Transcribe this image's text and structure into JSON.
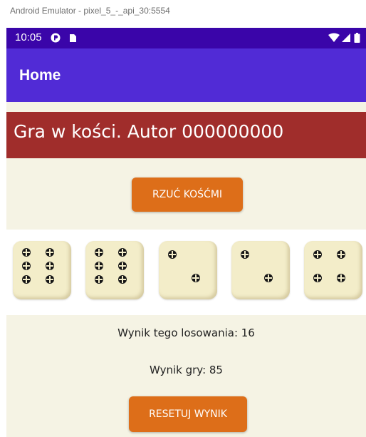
{
  "window": {
    "title": "Android Emulator - pixel_5_-_api_30:5554"
  },
  "status_bar": {
    "time": "10:05"
  },
  "app_bar": {
    "title": "Home"
  },
  "header": {
    "text": "Gra w kości. Autor 000000000"
  },
  "roll_button": {
    "label": "RZUĆ KOŚĆMI"
  },
  "dice": [
    6,
    6,
    2,
    2,
    4
  ],
  "results": {
    "roll_score": "Wynik tego losowania: 16",
    "game_score": "Wynik gry: 85"
  },
  "reset_button": {
    "label": "RESETUJ WYNIK"
  },
  "colors": {
    "status_bar": "#3a05a9",
    "app_bar": "#512bd6",
    "header_band": "#a02d2b",
    "button": "#dd6e19",
    "content_bg": "#f5f3e4"
  }
}
